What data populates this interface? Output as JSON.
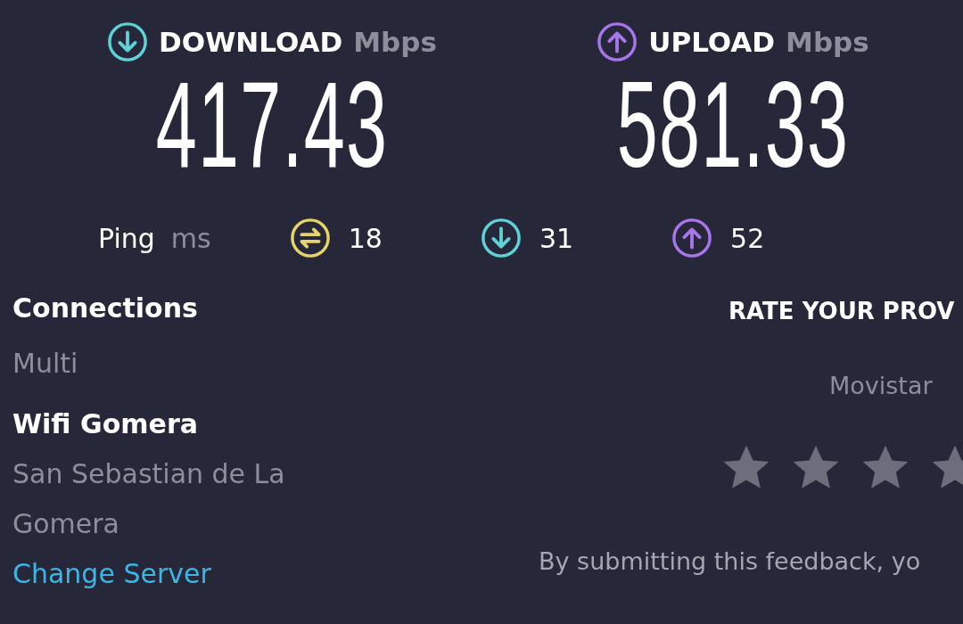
{
  "download": {
    "label": "DOWNLOAD",
    "unit": "Mbps",
    "value": "417.43"
  },
  "upload": {
    "label": "UPLOAD",
    "unit": "Mbps",
    "value": "581.33"
  },
  "ping": {
    "label": "Ping",
    "unit": "ms",
    "readings": [
      {
        "kind": "idle",
        "value": "18"
      },
      {
        "kind": "download",
        "value": "31"
      },
      {
        "kind": "upload",
        "value": "52"
      }
    ]
  },
  "connections": {
    "label": "Connections",
    "value": "Multi"
  },
  "server": {
    "name": "Wifi Gomera",
    "location": "San Sebastian de La Gomera",
    "link": "Change Server"
  },
  "rating": {
    "title": "RATE YOUR PROV",
    "provider": "Movistar",
    "stars": 0,
    "note": "By submitting this feedback, yo"
  }
}
